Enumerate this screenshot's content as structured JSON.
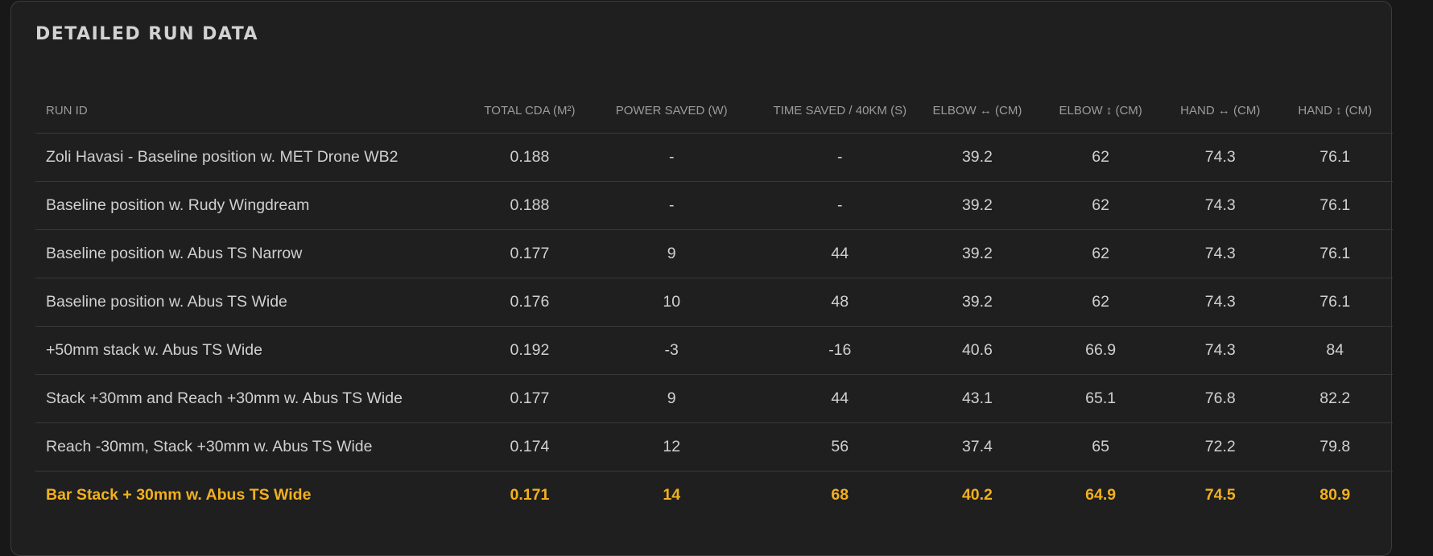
{
  "panel": {
    "title": "DETAILED RUN DATA"
  },
  "table": {
    "headers": [
      "RUN ID",
      "TOTAL CDA (M²)",
      "POWER SAVED (W)",
      "TIME SAVED / 40KM (S)",
      "ELBOW ↔ (CM)",
      "ELBOW ↕ (CM)",
      "HAND ↔ (CM)",
      "HAND ↕ (CM)"
    ],
    "rows": [
      [
        "Zoli Havasi - Baseline position w. MET Drone WB2",
        "0.188",
        "-",
        "-",
        "39.2",
        "62",
        "74.3",
        "76.1"
      ],
      [
        "Baseline position w. Rudy Wingdream",
        "0.188",
        "-",
        "-",
        "39.2",
        "62",
        "74.3",
        "76.1"
      ],
      [
        "Baseline position w. Abus TS Narrow",
        "0.177",
        "9",
        "44",
        "39.2",
        "62",
        "74.3",
        "76.1"
      ],
      [
        "Baseline position w. Abus TS Wide",
        "0.176",
        "10",
        "48",
        "39.2",
        "62",
        "74.3",
        "76.1"
      ],
      [
        "+50mm stack w. Abus TS Wide",
        "0.192",
        "-3",
        "-16",
        "40.6",
        "66.9",
        "74.3",
        "84"
      ],
      [
        "Stack +30mm and Reach +30mm w. Abus TS Wide",
        "0.177",
        "9",
        "44",
        "43.1",
        "65.1",
        "76.8",
        "82.2"
      ],
      [
        "Reach -30mm, Stack +30mm w. Abus TS Wide",
        "0.174",
        "12",
        "56",
        "37.4",
        "65",
        "72.2",
        "79.8"
      ],
      [
        "Bar Stack + 30mm w. Abus TS Wide",
        "0.171",
        "14",
        "68",
        "40.2",
        "64.9",
        "74.5",
        "80.9"
      ]
    ],
    "highlight_row_index": 7,
    "highlight_color": "#f2b01e"
  }
}
